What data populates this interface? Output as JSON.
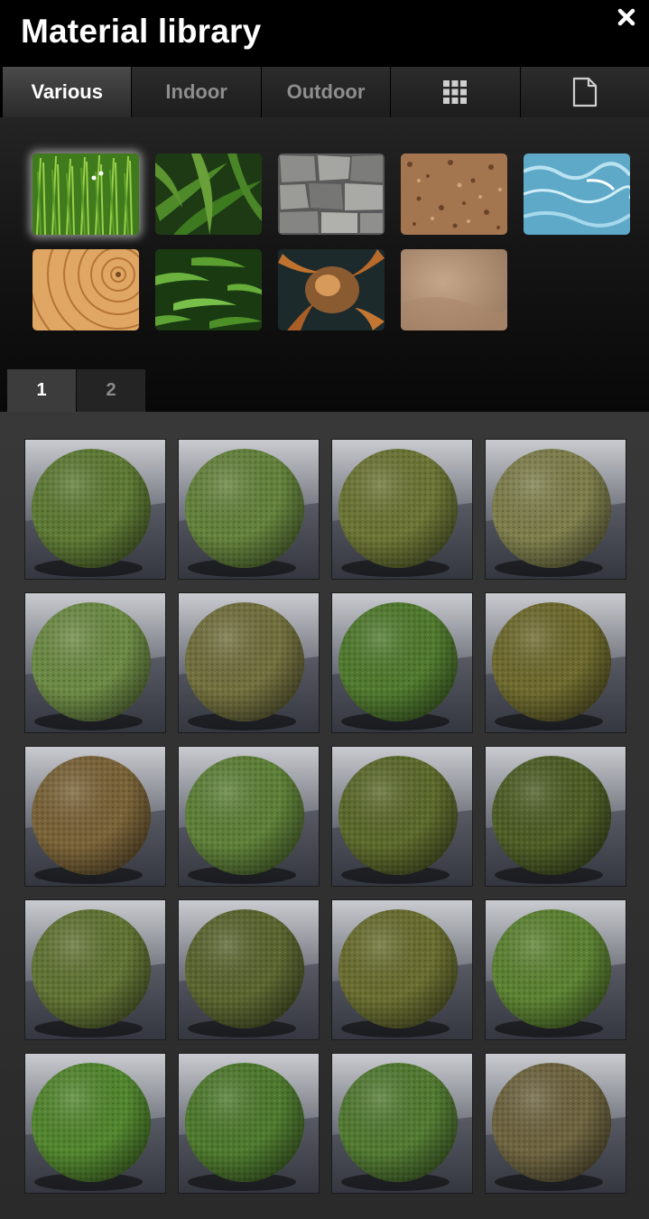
{
  "window": {
    "title": "Material library",
    "close_icon": "close-icon"
  },
  "tabs": [
    {
      "label": "Various",
      "active": true
    },
    {
      "label": "Indoor",
      "active": false
    },
    {
      "label": "Outdoor",
      "active": false
    },
    {
      "icon": "grid-view-icon",
      "active": false
    },
    {
      "icon": "file-icon",
      "active": false
    }
  ],
  "textures": [
    {
      "name": "grass",
      "selected": true
    },
    {
      "name": "leafy-plants"
    },
    {
      "name": "stone-wall"
    },
    {
      "name": "soil"
    },
    {
      "name": "water"
    },
    {
      "name": "wood-rings"
    },
    {
      "name": "bamboo-leaves"
    },
    {
      "name": "copper-organic"
    },
    {
      "name": "sand"
    }
  ],
  "pages": [
    {
      "label": "1",
      "active": true
    },
    {
      "label": "2",
      "active": false
    }
  ],
  "materials": [
    {
      "color": "#5e7a34"
    },
    {
      "color": "#64823c"
    },
    {
      "color": "#6c7535"
    },
    {
      "color": "#7e7e4c"
    },
    {
      "color": "#6c8a44"
    },
    {
      "color": "#72703e"
    },
    {
      "color": "#507a2e"
    },
    {
      "color": "#6e6a2e"
    },
    {
      "color": "#7a6338"
    },
    {
      "color": "#5e8038"
    },
    {
      "color": "#5c6a2c"
    },
    {
      "color": "#4e5e26"
    },
    {
      "color": "#627434"
    },
    {
      "color": "#5a6630"
    },
    {
      "color": "#6a6e30"
    },
    {
      "color": "#5c8232"
    },
    {
      "color": "#52862e"
    },
    {
      "color": "#4e7a2e"
    },
    {
      "color": "#527a32"
    },
    {
      "color": "#6e6440"
    }
  ]
}
